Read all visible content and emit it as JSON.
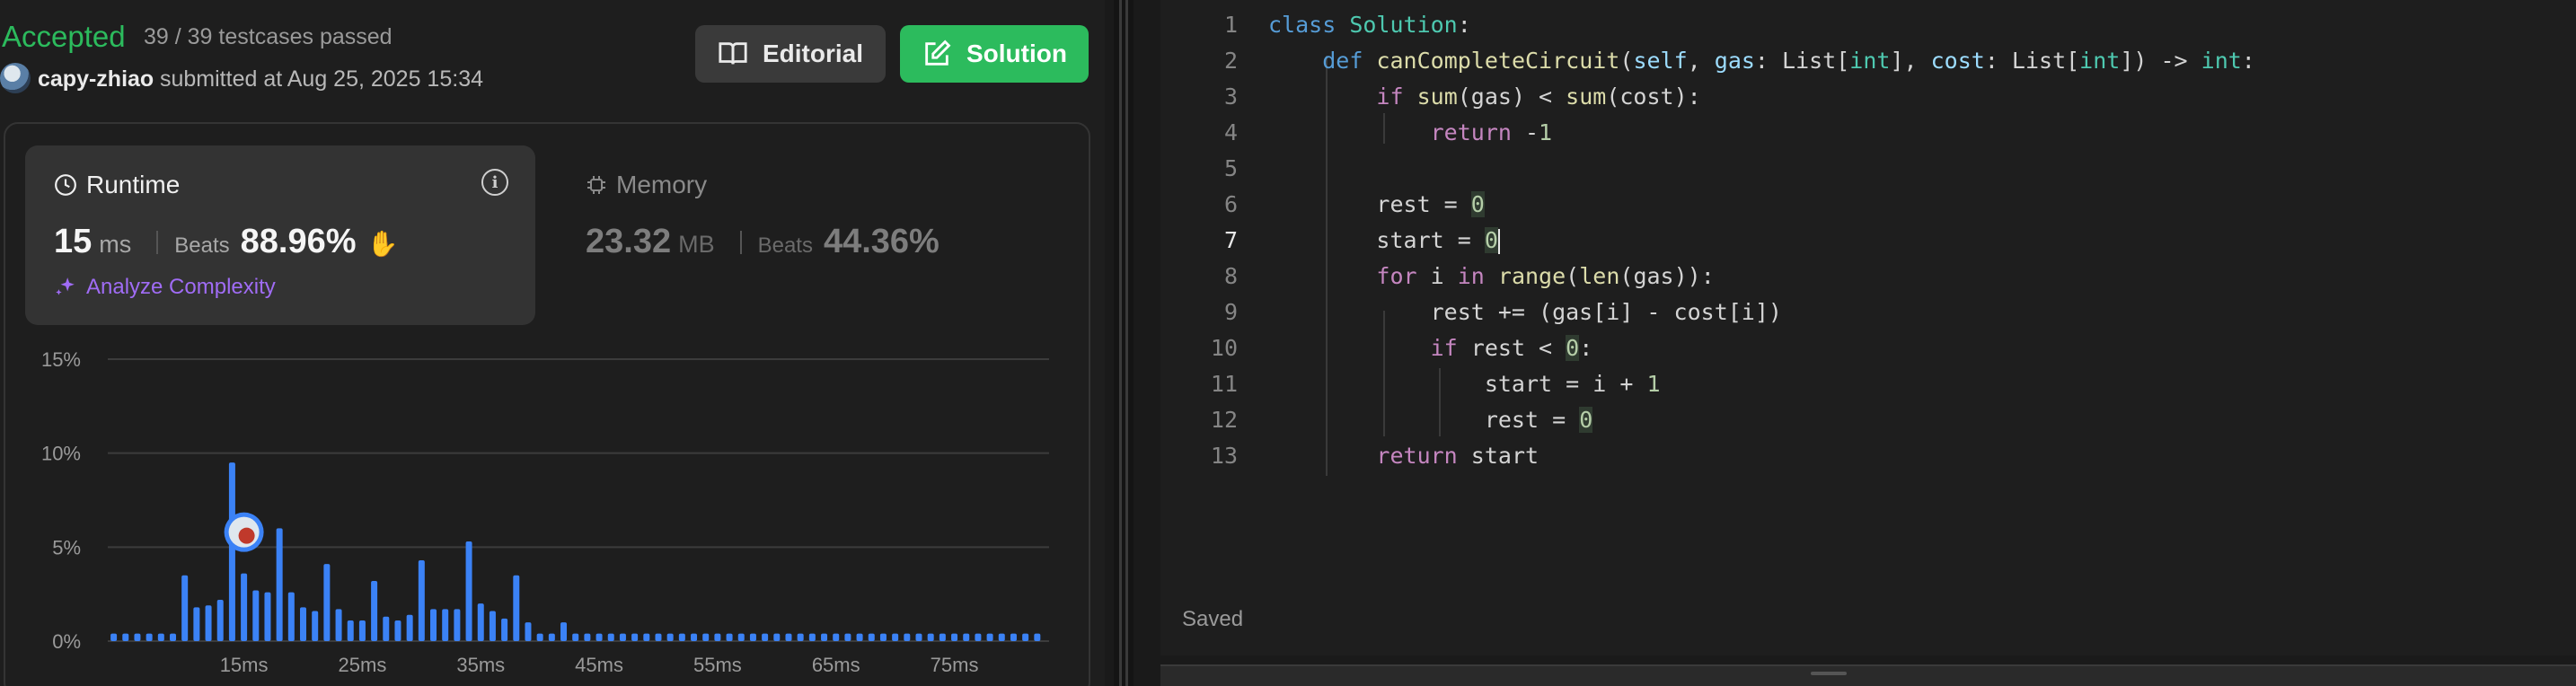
{
  "submission": {
    "status": "Accepted",
    "testcases": "39 / 39 testcases passed",
    "author": "capy-zhiao",
    "submitted_at": "submitted at Aug 25, 2025 15:34"
  },
  "buttons": {
    "editorial": "Editorial",
    "solution": "Solution"
  },
  "runtime": {
    "label": "Runtime",
    "value": "15",
    "unit": "ms",
    "beats_label": "Beats",
    "beats_value": "88.96%",
    "analyze": "Analyze Complexity"
  },
  "memory": {
    "label": "Memory",
    "value": "23.32",
    "unit": "MB",
    "beats_label": "Beats",
    "beats_value": "44.36%"
  },
  "chart_data": {
    "type": "bar",
    "y_tick_labels": [
      "15%",
      "10%",
      "5%",
      "0%"
    ],
    "ylim": [
      0,
      15
    ],
    "x_tick_labels": [
      "15ms",
      "25ms",
      "35ms",
      "45ms",
      "55ms",
      "65ms",
      "75ms"
    ],
    "x_tick_values": [
      15,
      25,
      35,
      45,
      55,
      65,
      75
    ],
    "x": [
      4,
      5,
      6,
      7,
      8,
      9,
      10,
      11,
      12,
      13,
      14,
      15,
      16,
      17,
      18,
      19,
      20,
      21,
      22,
      23,
      24,
      25,
      26,
      27,
      28,
      29,
      30,
      31,
      32,
      33,
      34,
      35,
      36,
      37,
      38,
      39,
      40,
      41,
      42,
      43,
      44,
      45,
      46,
      47,
      48,
      49,
      50,
      51,
      52,
      53,
      54,
      55,
      56,
      57,
      58,
      59,
      60,
      61,
      62,
      63,
      64,
      65,
      66,
      67,
      68,
      69,
      70,
      71,
      72,
      73,
      74,
      75,
      76,
      77,
      78,
      79,
      80,
      81,
      82
    ],
    "values": [
      0.4,
      0.4,
      0.4,
      0.4,
      0.4,
      0.4,
      3.5,
      1.8,
      1.9,
      2.2,
      9.5,
      3.6,
      2.7,
      2.6,
      6.0,
      2.6,
      1.8,
      1.6,
      4.1,
      1.7,
      1.1,
      1.1,
      3.2,
      1.3,
      1.1,
      1.4,
      4.3,
      1.7,
      1.7,
      1.7,
      5.3,
      2.0,
      1.6,
      1.2,
      3.5,
      1.0,
      0.4,
      0.4,
      1.0,
      0.4,
      0.4,
      0.4,
      0.4,
      0.4,
      0.4,
      0.4,
      0.4,
      0.4,
      0.4,
      0.4,
      0.4,
      0.4,
      0.4,
      0.4,
      0.4,
      0.4,
      0.4,
      0.4,
      0.4,
      0.4,
      0.4,
      0.4,
      0.4,
      0.4,
      0.4,
      0.4,
      0.4,
      0.4,
      0.4,
      0.4,
      0.4,
      0.4,
      0.4,
      0.4,
      0.4,
      0.4,
      0.4,
      0.4,
      0.4
    ],
    "highlight_x": 15,
    "bar_color": "#3b82f6",
    "grid": true
  },
  "editor": {
    "status": "Saved",
    "active_line": 7,
    "lines": [
      "1",
      "2",
      "3",
      "4",
      "5",
      "6",
      "7",
      "8",
      "9",
      "10",
      "11",
      "12",
      "13"
    ]
  },
  "colors": {
    "accepted": "#2cbb5d",
    "accent_purple": "#a06cf5",
    "bar": "#3b82f6"
  }
}
